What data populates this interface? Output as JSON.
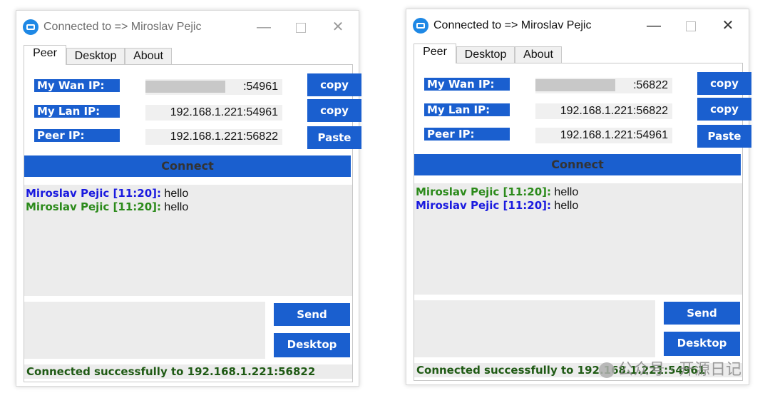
{
  "windows": [
    {
      "title": "Connected to => Miroslav Pejic",
      "controls": {
        "minimize": "—",
        "close": "✕"
      },
      "tabs": [
        {
          "label": "Peer"
        },
        {
          "label": "Desktop"
        },
        {
          "label": "About"
        }
      ],
      "wan_label": "My Wan IP:",
      "wan_value": ":54961",
      "lan_label": "My Lan IP:",
      "lan_value": "192.168.1.221:54961",
      "peer_label": "Peer IP:",
      "peer_value": "192.168.1.221:56822",
      "copy_label": "copy",
      "paste_label": "Paste",
      "connect_label": "Connect",
      "messages": [
        {
          "sender": "Miroslav Pejic [11:20]:",
          "text": " hello",
          "color": "#1a1adf"
        },
        {
          "sender": "Miroslav Pejic [11:20]:",
          "text": " hello",
          "color": "#2b8a1a"
        }
      ],
      "send_label": "Send",
      "desktop_label": "Desktop",
      "status": "Connected successfully to 192.168.1.221:56822"
    },
    {
      "title": "Connected to => Miroslav Pejic",
      "controls": {
        "minimize": "—",
        "close": "✕"
      },
      "tabs": [
        {
          "label": "Peer"
        },
        {
          "label": "Desktop"
        },
        {
          "label": "About"
        }
      ],
      "wan_label": "My Wan IP:",
      "wan_value": ":56822",
      "lan_label": "My Lan IP:",
      "lan_value": "192.168.1.221:56822",
      "peer_label": "Peer IP:",
      "peer_value": "192.168.1.221:54961",
      "copy_label": "copy",
      "paste_label": "Paste",
      "connect_label": "Connect",
      "messages": [
        {
          "sender": "Miroslav Pejic [11:20]:",
          "text": " hello",
          "color": "#2b8a1a"
        },
        {
          "sender": "Miroslav Pejic [11:20]:",
          "text": " hello",
          "color": "#1a1adf"
        }
      ],
      "send_label": "Send",
      "desktop_label": "Desktop",
      "status": "Connected successfully to 192.168.1.221:54961"
    }
  ],
  "watermark": "公众号 · 开源日记",
  "colors": {
    "accent": "#1a5fcf",
    "status_text": "#1f5a14",
    "panel_bg": "#ececec"
  }
}
